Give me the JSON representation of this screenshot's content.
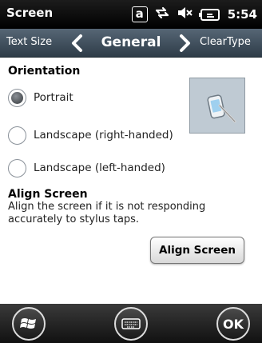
{
  "status_bar": {
    "title": "Screen",
    "time": "5:54",
    "icons": [
      "a-key-icon",
      "connection-arrows-icon",
      "volume-muted-icon",
      "battery-icon"
    ],
    "a_key_label": "a"
  },
  "nav": {
    "prev_label": "Text Size",
    "title": "General",
    "next_label": "ClearType"
  },
  "orientation": {
    "heading": "Orientation",
    "options": [
      {
        "label": "Portrait",
        "checked": true
      },
      {
        "label": "Landscape (right-handed)",
        "checked": false
      },
      {
        "label": "Landscape (left-handed)",
        "checked": false
      }
    ]
  },
  "align": {
    "heading": "Align Screen",
    "description": "Align the screen if it is not responding accurately to stylus taps.",
    "button_label": "Align Screen"
  },
  "bottom_bar": {
    "ok_label": "OK"
  },
  "colors": {
    "nav_bg": "#3c4a57",
    "orientation_box": "#bfcad3"
  }
}
